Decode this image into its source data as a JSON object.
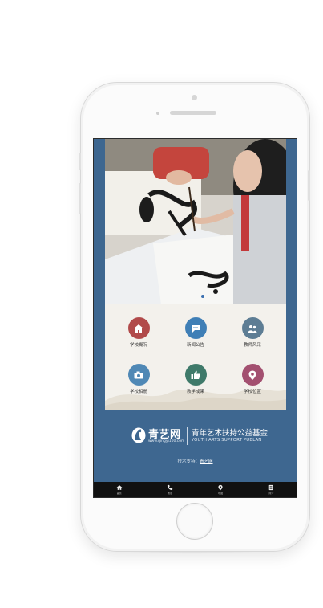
{
  "menu": [
    {
      "label": "学校概况",
      "icon": "home-icon",
      "color": "#b14a4a"
    },
    {
      "label": "新闻公告",
      "icon": "chat-icon",
      "color": "#3f7fb6"
    },
    {
      "label": "教师风采",
      "icon": "people-icon",
      "color": "#5d7d94"
    },
    {
      "label": "学校相册",
      "icon": "camera-icon",
      "color": "#4f88b5"
    },
    {
      "label": "教学成果",
      "icon": "thumbs-up-icon",
      "color": "#3f7a6a"
    },
    {
      "label": "学校位置",
      "icon": "location-pin-icon",
      "color": "#a35070"
    }
  ],
  "brand": {
    "name": "青艺网",
    "url": "www.qingyi100.com",
    "slogan": "青年艺术扶持公益基金",
    "slogan_en": "YOUTH ARTS SUPPORT PUBLAN"
  },
  "support": {
    "prefix": "技术支持：",
    "link": "青艺网"
  },
  "tabbar": [
    {
      "label": "首页",
      "icon": "home-icon"
    },
    {
      "label": "电话",
      "icon": "phone-icon"
    },
    {
      "label": "地图",
      "icon": "location-pin-icon"
    },
    {
      "label": "简介",
      "icon": "document-icon"
    }
  ],
  "colors": {
    "screen_bg": "#3e6790",
    "tabbar_bg": "#111111",
    "menu_bg": "#f3f1ec"
  }
}
